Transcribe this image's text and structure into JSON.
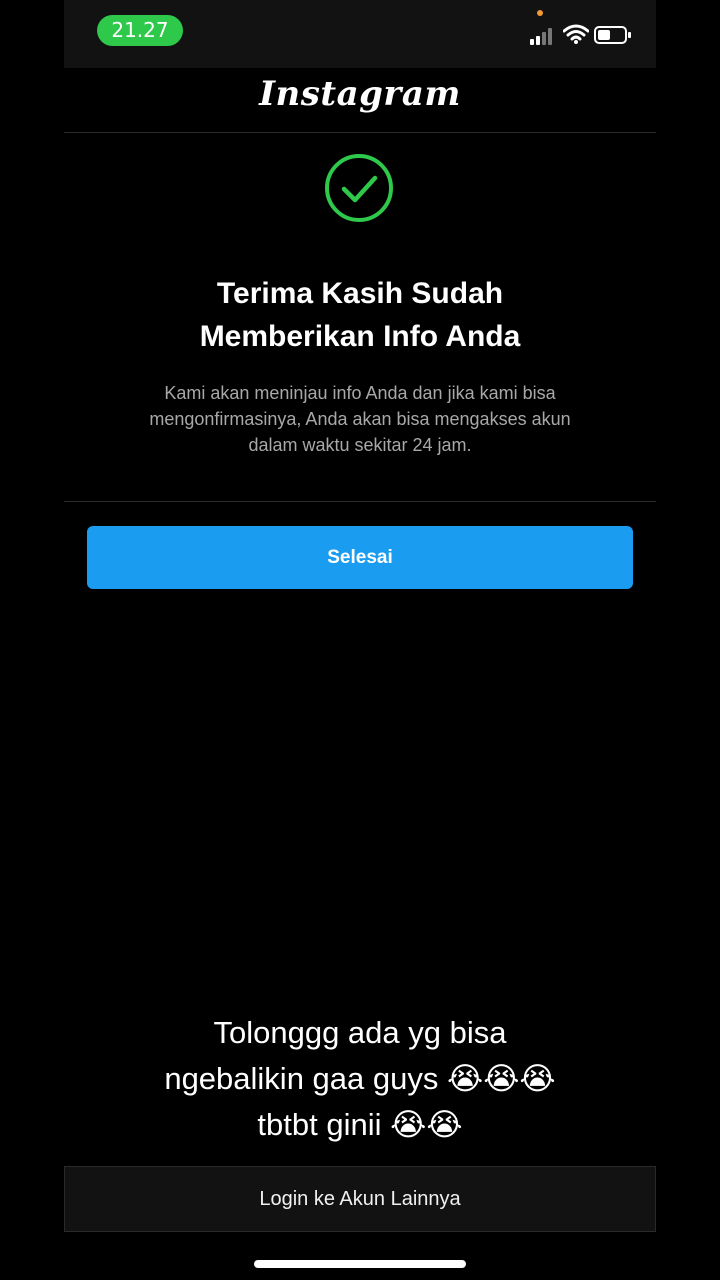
{
  "status_bar": {
    "time": "21.27"
  },
  "header": {
    "logo": "Instagram"
  },
  "confirmation": {
    "title_lines": [
      "Terima Kasih Sudah",
      "Memberikan Info Anda"
    ],
    "description_lines": [
      "Kami akan meninjau info Anda dan jika kami bisa",
      "mengonfirmasinya, Anda akan bisa mengakses akun",
      "dalam waktu sekitar 24 jam."
    ],
    "done_label": "Selesai"
  },
  "caption": {
    "lines": [
      "Tolonggg ada yg bisa",
      "ngebalikin gaa guys 😭😭😭",
      "tbtbt ginii 😭😭"
    ]
  },
  "footer": {
    "other_account_label": "Login ke Akun Lainnya"
  },
  "colors": {
    "accent": "#1a9cf0",
    "success": "#2ec84a",
    "status_pill": "#2ec84a"
  },
  "icons": {
    "check": "check-circle-icon",
    "signal": "signal-icon",
    "wifi": "wifi-icon",
    "battery": "battery-icon"
  }
}
